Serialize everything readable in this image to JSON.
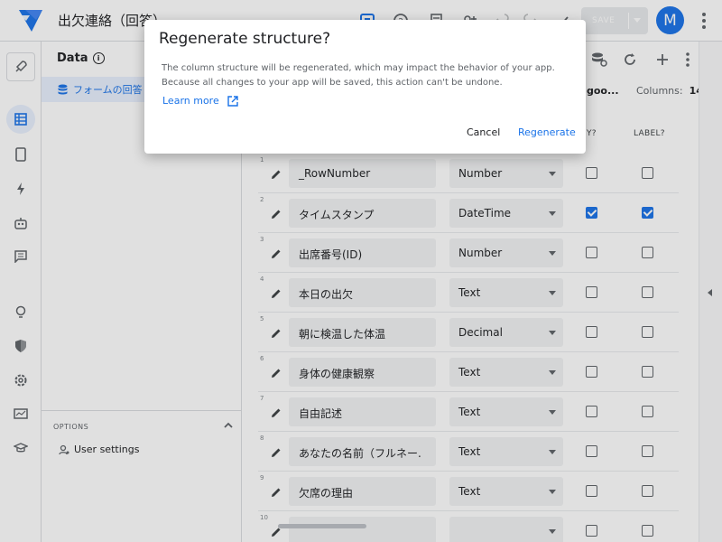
{
  "header": {
    "app_title": "出欠連絡（回答）",
    "save_label": "SAVE",
    "avatar_initial": "M",
    "brand_color": "#1a73e8"
  },
  "rail": {
    "items": [
      {
        "icon": "rocket-icon"
      },
      {
        "icon": "table-icon"
      },
      {
        "icon": "phone-icon"
      },
      {
        "icon": "bolt-icon"
      },
      {
        "icon": "robot-icon"
      },
      {
        "icon": "chat-icon"
      },
      {
        "icon": "lightbulb-icon"
      },
      {
        "icon": "shield-icon"
      },
      {
        "icon": "gear-icon"
      },
      {
        "icon": "monitor-icon"
      },
      {
        "icon": "graduation-cap-icon"
      }
    ]
  },
  "panel": {
    "title": "Data",
    "table_label": "フォームの回答",
    "options_label": "OPTIONS",
    "user_settings_label": "User settings"
  },
  "main": {
    "source_label": "goo...",
    "columns_label": "Columns:",
    "columns_count": "14",
    "headers": {
      "key": "Y?",
      "label": "LABEL?"
    },
    "rows": [
      {
        "num": "1",
        "name": "_RowNumber",
        "type": "Number",
        "key": false,
        "label": false
      },
      {
        "num": "2",
        "name": "タイムスタンプ",
        "type": "DateTime",
        "key": true,
        "label": true
      },
      {
        "num": "3",
        "name": "出席番号(ID)",
        "type": "Number",
        "key": false,
        "label": false
      },
      {
        "num": "4",
        "name": "本日の出欠",
        "type": "Text",
        "key": false,
        "label": false
      },
      {
        "num": "5",
        "name": "朝に検温した体温",
        "type": "Decimal",
        "key": false,
        "label": false
      },
      {
        "num": "6",
        "name": "身体の健康観察",
        "type": "Text",
        "key": false,
        "label": false
      },
      {
        "num": "7",
        "name": "自由記述",
        "type": "Text",
        "key": false,
        "label": false
      },
      {
        "num": "8",
        "name": "あなたの名前（フルネー.",
        "type": "Text",
        "key": false,
        "label": false
      },
      {
        "num": "9",
        "name": "欠席の理由",
        "type": "Text",
        "key": false,
        "label": false
      },
      {
        "num": "10",
        "name": "",
        "type": "",
        "key": false,
        "label": false
      }
    ]
  },
  "dialog": {
    "title": "Regenerate structure?",
    "body_line1": "The column structure will be regenerated, which may impact the behavior of your app.",
    "body_line2": "Because all changes to your app will be saved, this action can't be undone.",
    "learn_more": "Learn more",
    "cancel": "Cancel",
    "regenerate": "Regenerate"
  }
}
